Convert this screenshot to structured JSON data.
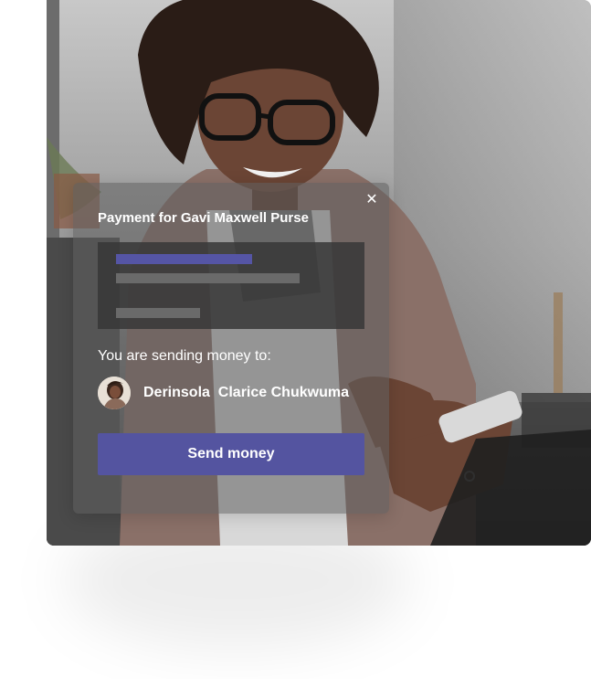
{
  "modal": {
    "close_icon": "✕",
    "title": "Payment for Gavi Maxwell Purse",
    "sending_label": "You are sending money to:",
    "recipient_name": "Derinsola  Clarice Chukwuma",
    "send_button_label": "Send money"
  },
  "colors": {
    "accent": "#5454a0",
    "skeleton_accent": "#5555a5"
  },
  "icons": {
    "close": "close-icon",
    "avatar": "avatar"
  }
}
